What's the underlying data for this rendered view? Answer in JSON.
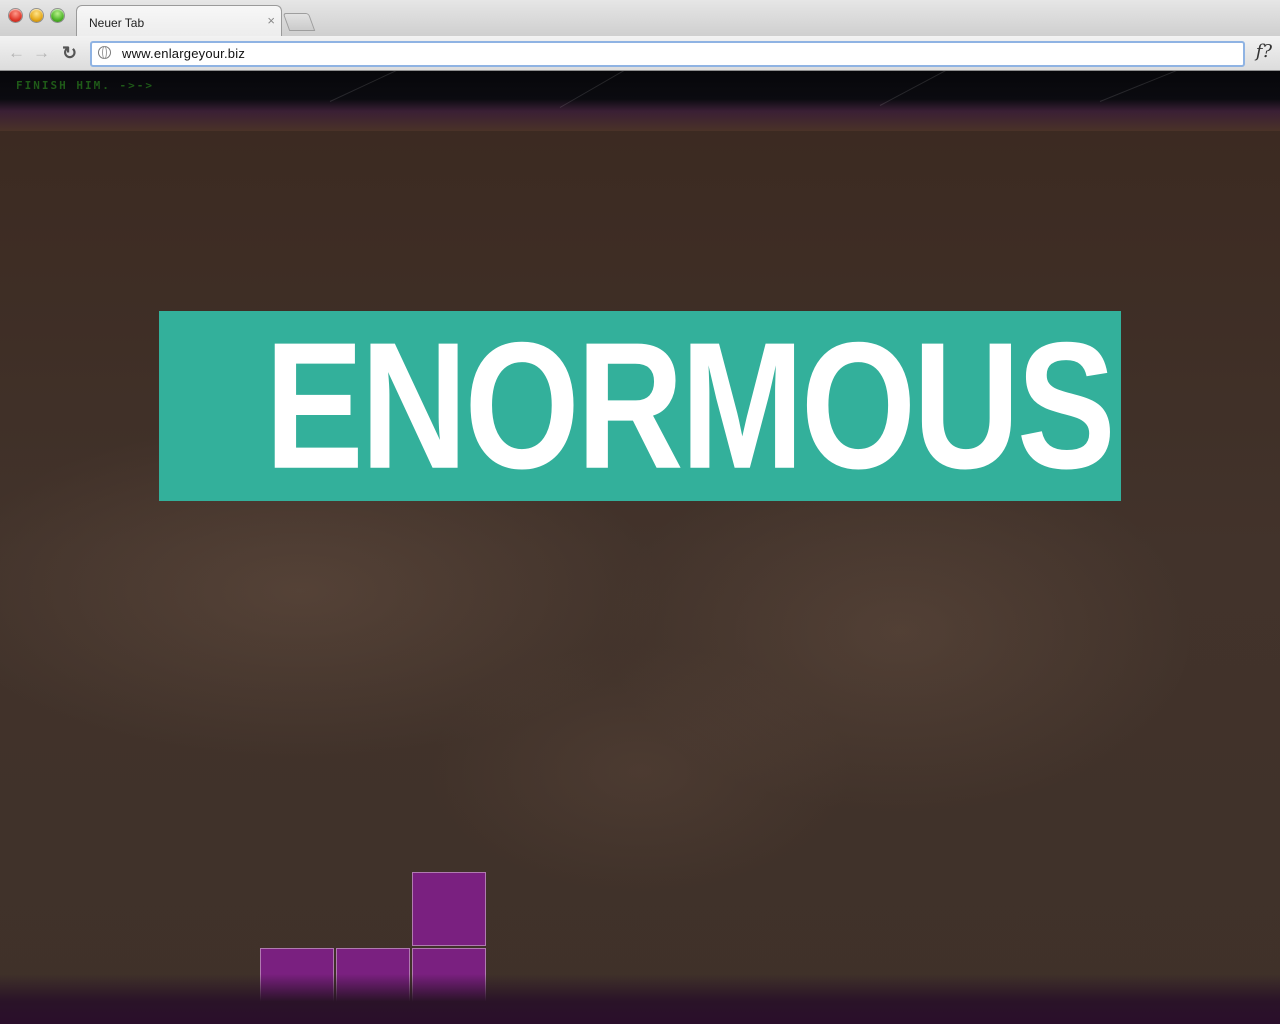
{
  "browser": {
    "tab_title": "Neuer Tab",
    "tab_close": "×",
    "url": "www.enlargeyour.biz",
    "back_label": "←",
    "forward_label": "→",
    "reload_label": "↻",
    "menu_label": "f?"
  },
  "page": {
    "hint_text": "FINISH HIM. ->->",
    "banner_text": "ENORMOUS",
    "colors": {
      "banner": "#33b09b",
      "block": "#7a2080",
      "hint": "#1f5a18"
    }
  }
}
